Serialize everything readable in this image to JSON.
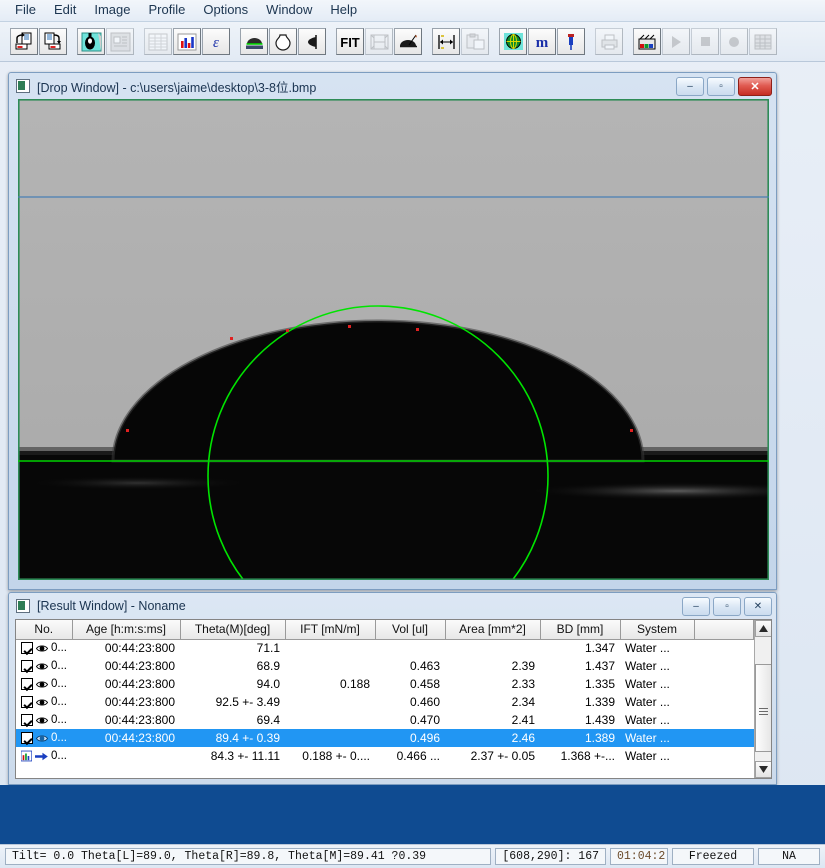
{
  "menu": {
    "items": [
      "File",
      "Edit",
      "Image",
      "Profile",
      "Options",
      "Window",
      "Help"
    ]
  },
  "toolbar": {
    "buttons": [
      {
        "name": "open-file-icon",
        "glyph": "open",
        "enabled": true
      },
      {
        "name": "save-file-icon",
        "glyph": "save",
        "enabled": true
      },
      {
        "name": "drop-image-icon",
        "glyph": "drop",
        "enabled": true
      },
      {
        "name": "image-database-icon",
        "glyph": "db",
        "enabled": false
      },
      {
        "name": "table-view-icon",
        "glyph": "table",
        "enabled": false
      },
      {
        "name": "bar-chart-icon",
        "glyph": "chart",
        "enabled": true
      },
      {
        "name": "epsilon-icon",
        "glyph": "eps",
        "enabled": true
      },
      {
        "name": "sessile-drop-icon",
        "glyph": "sessile",
        "enabled": true
      },
      {
        "name": "pendant-drop-icon",
        "glyph": "pendant",
        "enabled": true
      },
      {
        "name": "half-profile-icon",
        "glyph": "half",
        "enabled": true
      },
      {
        "name": "fit-icon",
        "glyph": "FIT",
        "enabled": true
      },
      {
        "name": "frame-measure-icon",
        "glyph": "frame",
        "enabled": false
      },
      {
        "name": "tilt-drop-icon",
        "glyph": "tilt",
        "enabled": true
      },
      {
        "name": "calibrate-width-icon",
        "glyph": "calib",
        "enabled": true
      },
      {
        "name": "copy-clipboard-icon",
        "glyph": "clip",
        "enabled": false
      },
      {
        "name": "globe-icon",
        "glyph": "globe",
        "enabled": true
      },
      {
        "name": "magnification-m-icon",
        "glyph": "m",
        "enabled": true
      },
      {
        "name": "syringe-icon",
        "glyph": "syringe",
        "enabled": true
      },
      {
        "name": "print-icon",
        "glyph": "print",
        "enabled": false
      },
      {
        "name": "movie-icon",
        "glyph": "movie",
        "enabled": true
      },
      {
        "name": "play-icon",
        "glyph": "play",
        "enabled": false
      },
      {
        "name": "stop-icon",
        "glyph": "stop",
        "enabled": false
      },
      {
        "name": "record-icon",
        "glyph": "record",
        "enabled": false
      },
      {
        "name": "grid-icon",
        "glyph": "grid",
        "enabled": false
      }
    ]
  },
  "drop_window": {
    "title": "[Drop Window] - c:\\users\\jaime\\desktop\\3-8位.bmp",
    "minimize_label": "–",
    "maximize_label": "▫",
    "close_label": "✕",
    "colors": {
      "background_gray": "#b0b0b0",
      "contour_green": "#00e400",
      "baseline_green": "#00d200",
      "reference_blue": "#4a7fb5",
      "drop_black": "#060606"
    }
  },
  "result_window": {
    "title": "[Result Window] - Noname",
    "minimize_label": "–",
    "maximize_label": "▫",
    "close_label": "✕",
    "columns": [
      "No.",
      "Age [h:m:s:ms]",
      "Theta(M)[deg]",
      "IFT [mN/m]",
      "Vol [ul]",
      "Area [mm*2]",
      "BD [mm]",
      "System",
      ""
    ],
    "rows": [
      {
        "no": "0...",
        "checked": true,
        "age": "00:44:23:800",
        "theta": "71.1",
        "ift": "",
        "vol": "",
        "area": "",
        "bd": "1.347",
        "system": "Water ...",
        "selected": false,
        "kind": "data"
      },
      {
        "no": "0...",
        "checked": true,
        "age": "00:44:23:800",
        "theta": "68.9",
        "ift": "",
        "vol": "0.463",
        "area": "2.39",
        "bd": "1.437",
        "system": "Water ...",
        "selected": false,
        "kind": "data"
      },
      {
        "no": "0...",
        "checked": true,
        "age": "00:44:23:800",
        "theta": "94.0",
        "ift": "0.188",
        "vol": "0.458",
        "area": "2.33",
        "bd": "1.335",
        "system": "Water ...",
        "selected": false,
        "kind": "data"
      },
      {
        "no": "0...",
        "checked": true,
        "age": "00:44:23:800",
        "theta": "92.5 +- 3.49",
        "ift": "",
        "vol": "0.460",
        "area": "2.34",
        "bd": "1.339",
        "system": "Water ...",
        "selected": false,
        "kind": "data"
      },
      {
        "no": "0...",
        "checked": true,
        "age": "00:44:23:800",
        "theta": "69.4",
        "ift": "",
        "vol": "0.470",
        "area": "2.41",
        "bd": "1.439",
        "system": "Water ...",
        "selected": false,
        "kind": "data"
      },
      {
        "no": "0...",
        "checked": true,
        "age": "00:44:23:800",
        "theta": "89.4 +- 0.39",
        "ift": "",
        "vol": "0.496",
        "area": "2.46",
        "bd": "1.389",
        "system": "Water ...",
        "selected": true,
        "kind": "data"
      },
      {
        "no": "0...",
        "checked": false,
        "age": "",
        "theta": "84.3 +- 11.11",
        "ift": "0.188 +- 0....",
        "vol": "0.466 ...",
        "area": "2.37 +- 0.05",
        "bd": "1.368 +-...",
        "system": "Water ...",
        "selected": false,
        "kind": "summary"
      }
    ]
  },
  "status_bar": {
    "measurement": "Tilt= 0.0  Theta[L]=89.0,  Theta[R]=89.8,  Theta[M]=89.41 ?0.39",
    "coordinates": "[608,290]: 167",
    "time": "01:04:2",
    "state": "Freezed",
    "na": "NA"
  }
}
